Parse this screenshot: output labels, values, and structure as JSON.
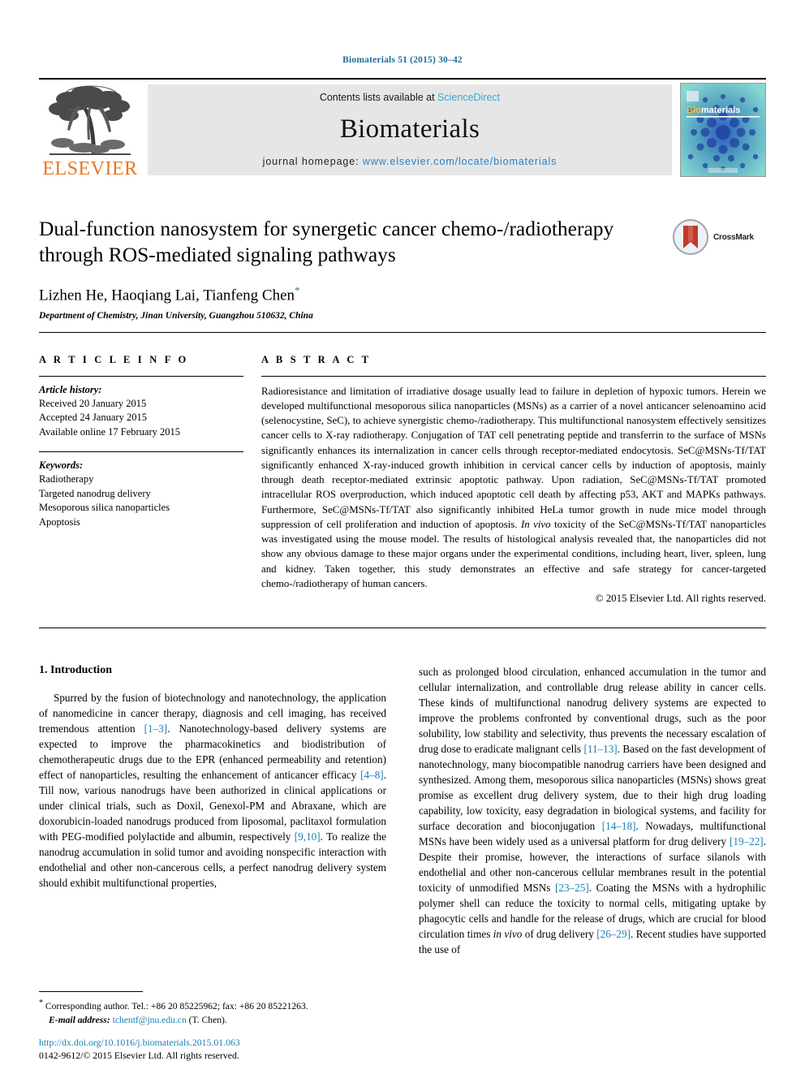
{
  "running_head": "Biomaterials 51 (2015) 30–42",
  "banner": {
    "publisher_name": "ELSEVIER",
    "contents_prefix": "Contents lists available at ",
    "contents_link": "ScienceDirect",
    "journal_name": "Biomaterials",
    "homepage_prefix": "journal homepage: ",
    "homepage_url": "www.elsevier.com/locate/biomaterials",
    "cover_title_bio": "Bio",
    "cover_title_materials": "materials"
  },
  "article": {
    "title_line1": "Dual-function nanosystem for synergetic cancer chemo-/radiotherapy",
    "title_line2": "through ROS-mediated signaling pathways",
    "crossmark_label": "CrossMark",
    "authors": "Lizhen He, Haoqiang Lai, Tianfeng Chen",
    "author_star": "*",
    "affiliation": "Department of Chemistry, Jinan University, Guangzhou 510632, China"
  },
  "article_info": {
    "heading": "A R T I C L E   I N F O",
    "history_label": "Article history:",
    "history": [
      "Received 20 January 2015",
      "Accepted 24 January 2015",
      "Available online 17 February 2015"
    ],
    "keywords_label": "Keywords:",
    "keywords": [
      "Radiotherapy",
      "Targeted nanodrug delivery",
      "Mesoporous silica nanoparticles",
      "Apoptosis"
    ]
  },
  "abstract": {
    "heading": "A B S T R A C T",
    "part1": "Radioresistance and limitation of irradiative dosage usually lead to failure in depletion of hypoxic tumors. Herein we developed multifunctional mesoporous silica nanoparticles (MSNs) as a carrier of a novel anticancer selenoamino acid (selenocystine, SeC), to achieve synergistic chemo-/radiotherapy. This multifunctional nanosystem effectively sensitizes cancer cells to X-ray radiotherapy. Conjugation of TAT cell penetrating peptide and transferrin to the surface of MSNs significantly enhances its internalization in cancer cells through receptor-mediated endocytosis. SeC@MSNs-Tf/TAT significantly enhanced X-ray-induced growth inhibition in cervical cancer cells by induction of apoptosis, mainly through death receptor-mediated extrinsic apoptotic pathway. Upon radiation, SeC@MSNs-Tf/TAT promoted intracellular ROS overproduction, which induced apoptotic cell death by affecting p53, AKT and MAPKs pathways. Furthermore, SeC@MSNs-Tf/TAT also significantly inhibited HeLa tumor growth in nude mice model through suppression of cell proliferation and induction of apoptosis. ",
    "italic_phrase": "In vivo",
    "part2": " toxicity of the SeC@MSNs-Tf/TAT nanoparticles was investigated using the mouse model. The results of histological analysis revealed that, the nanoparticles did not show any obvious damage to these major organs under the experimental conditions, including heart, liver, spleen, lung and kidney. Taken together, this study demonstrates an effective and safe strategy for cancer-targeted chemo-/radiotherapy of human cancers.",
    "copyright": "© 2015 Elsevier Ltd. All rights reserved."
  },
  "introduction": {
    "heading": "1. Introduction",
    "left_p1_a": "Spurred by the fusion of biotechnology and nanotechnology, the application of nanomedicine in cancer therapy, diagnosis and cell imaging, has received tremendous attention ",
    "left_ref1": "[1–3]",
    "left_p1_b": ". Nanotechnology-based delivery systems are expected to improve the pharmacokinetics and biodistribution of chemotherapeutic drugs due to the EPR (enhanced permeability and retention) effect of nanoparticles, resulting the enhancement of anticancer efficacy ",
    "left_ref2": "[4–8]",
    "left_p1_c": ". Till now, various nanodrugs have been authorized in clinical applications or under clinical trials, such as Doxil, Genexol-PM and Abraxane, which are doxorubicin-loaded nanodrugs produced from liposomal, paclitaxol formulation with PEG-modified polylactide and albumin, respectively ",
    "left_ref3": "[9,10]",
    "left_p1_d": ". To realize the nanodrug accumulation in solid tumor and avoiding nonspecific interaction with endothelial and other non-cancerous cells, a perfect nanodrug delivery system should exhibit multifunctional properties,",
    "right_a": "such as prolonged blood circulation, enhanced accumulation in the tumor and cellular internalization, and controllable drug release ability in cancer cells. These kinds of multifunctional nanodrug delivery systems are expected to improve the problems confronted by conventional drugs, such as the poor solubility, low stability and selectivity, thus prevents the necessary escalation of drug dose to eradicate malignant cells ",
    "right_ref1": "[11–13]",
    "right_b": ". Based on the fast development of nanotechnology, many biocompatible nanodrug carriers have been designed and synthesized. Among them, mesoporous silica nanoparticles (MSNs) shows great promise as excellent drug delivery system, due to their high drug loading capability, low toxicity, easy degradation in biological systems, and facility for surface decoration and bioconjugation ",
    "right_ref2": "[14–18]",
    "right_c": ". Nowadays, multifunctional MSNs have been widely used as a universal platform for drug delivery ",
    "right_ref3": "[19–22]",
    "right_d": ". Despite their promise, however, the interactions of surface silanols with endothelial and other non-cancerous cellular membranes result in the potential toxicity of unmodified MSNs ",
    "right_ref4": "[23–25]",
    "right_e": ". Coating the MSNs with a hydrophilic polymer shell can reduce the toxicity to normal cells, mitigating uptake by phagocytic cells and handle for the release of drugs, which are crucial for blood circulation times ",
    "right_ital": "in vivo",
    "right_f": " of drug delivery ",
    "right_ref5": "[26–29]",
    "right_g": ". Recent studies have supported the use of"
  },
  "footer": {
    "corr_star": "*",
    "corr_text": " Corresponding author. Tel.: +86 20 85225962; fax: +86 20 85221263.",
    "email_label": "E-mail address:",
    "email": "tchentf@jnu.edu.cn",
    "email_suffix": " (T. Chen).",
    "doi_url": "http://dx.doi.org/10.1016/j.biomaterials.2015.01.063",
    "issn_line": "0142-9612/© 2015 Elsevier Ltd. All rights reserved."
  },
  "colors": {
    "link_blue": "#1a7fb5",
    "sciencedirect_blue": "#3aa6d8",
    "elsevier_orange": "#E87722",
    "running_head_blue": "#1a6f9c",
    "cover_teal": "#7fd0cf",
    "cover_darkblue": "#1e3f9e",
    "crossmark_red": "#c0392b"
  }
}
